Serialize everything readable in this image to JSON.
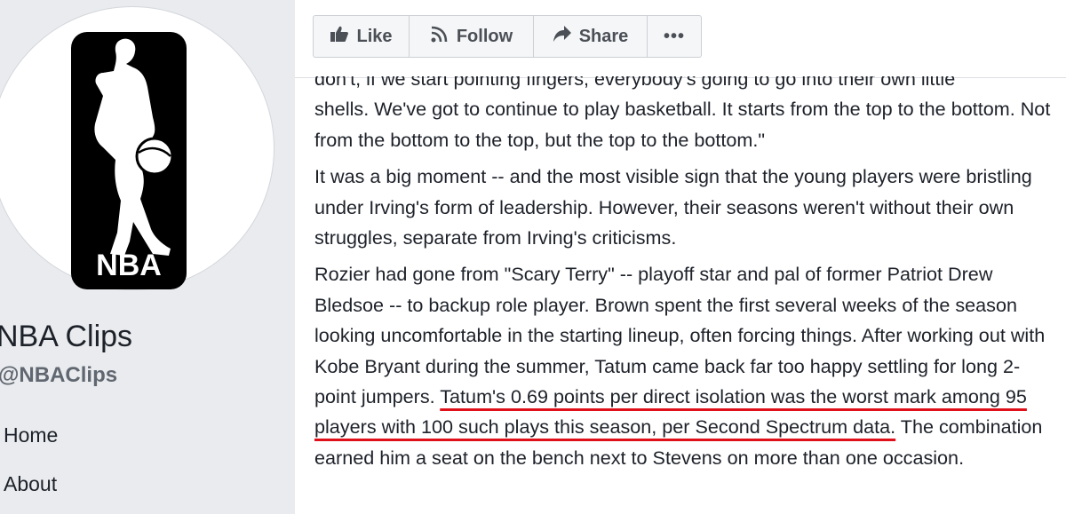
{
  "page": {
    "name": "NBA Clips",
    "handle": "@NBAClips",
    "logo_text": "NBA"
  },
  "nav": {
    "items": [
      "Home",
      "About"
    ]
  },
  "actions": {
    "like": "Like",
    "follow": "Follow",
    "share": "Share",
    "more": "•••"
  },
  "article": {
    "p1_line_a": "don't, if we start pointing fingers, everybody's going to go into their own little",
    "p1_rest": "shells. We've got to continue to play basketball. It starts from the top to the bottom. Not from the bottom to the top, but the top to the bottom.\"",
    "p2": "It was a big moment -- and the most visible sign that the young players were bristling under Irving's form of leadership. However, their seasons weren't without their own struggles, separate from Irving's criticisms.",
    "p3_before": "Rozier had gone from \"Scary Terry\" -- playoff star and pal of former Patriot Drew Bledsoe -- to backup role player. Brown spent the first several weeks of the season looking uncomfortable in the starting lineup, often forcing things. After working out with Kobe Bryant during the summer, Tatum came back far too happy settling for long 2-point jumpers. ",
    "p3_highlight": "Tatum's 0.69 points per direct isolation was the worst mark among 95 players with 100 such plays this season, per Second Spectrum data.",
    "p3_after": " The combination earned him a seat on the bench next to Stevens on more than one occasion."
  },
  "colors": {
    "highlight_underline": "#e0101a",
    "sidebar_bg": "#e9ebee"
  }
}
